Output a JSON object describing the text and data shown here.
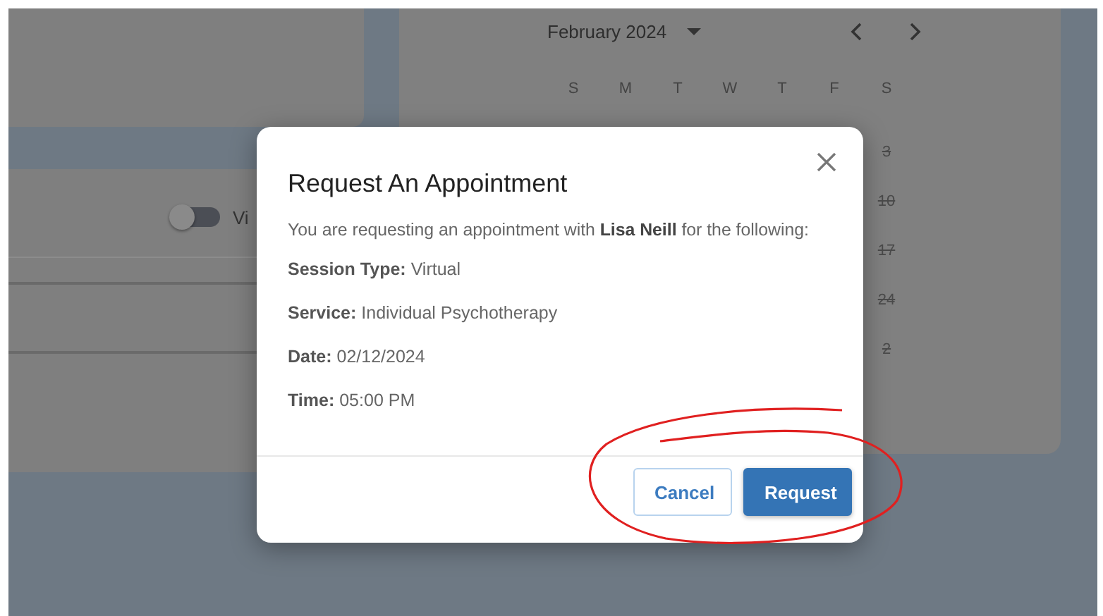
{
  "background": {
    "left_panel": {
      "toggle": {
        "on": false
      },
      "toggle_label": "Vi"
    },
    "calendar": {
      "month": "February 2024",
      "weekdays": [
        "S",
        "M",
        "T",
        "W",
        "T",
        "F",
        "S"
      ],
      "days": [
        {
          "text": "3",
          "disabled": true
        },
        {
          "text": "10",
          "disabled": true
        },
        {
          "text": "17",
          "disabled": true
        },
        {
          "text": "24",
          "disabled": true
        },
        {
          "text": "2",
          "disabled": true
        }
      ]
    }
  },
  "dialog": {
    "title": "Request An Appointment",
    "intro": "You are requesting an appointment with **Lisa Neill** for the following:",
    "details": [
      {
        "label": "Session Type:",
        "value": "Virtual"
      },
      {
        "label": "Service:",
        "value": "Individual Psychotherapy"
      },
      {
        "label": "Date:",
        "value": "02/12/2024"
      },
      {
        "label": "Time:",
        "value": "05:00 PM"
      }
    ],
    "buttons": [
      {
        "label": "Cancel",
        "kind": "secondary"
      },
      {
        "label": "Request",
        "kind": "primary"
      }
    ]
  },
  "annotation": {
    "kind": "ellipse"
  }
}
